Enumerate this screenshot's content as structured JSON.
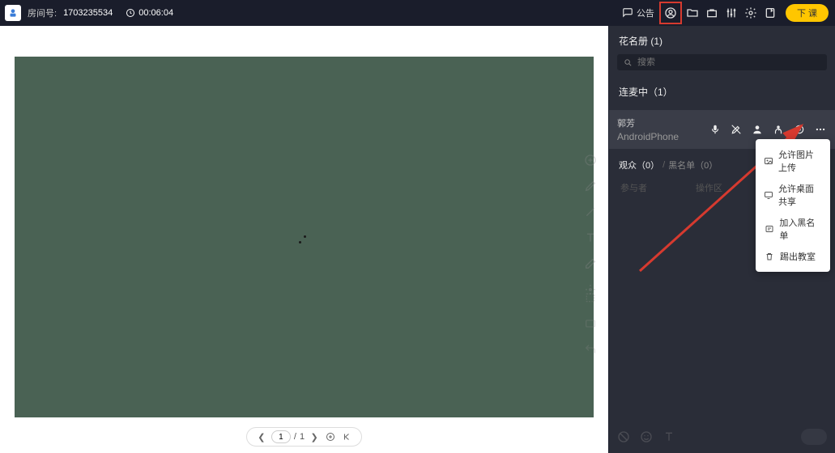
{
  "header": {
    "room_label": "房间号:",
    "room_id": "1703235534",
    "timer": "00:06:04",
    "announce_label": "公告",
    "end_class": "下 课"
  },
  "pager": {
    "current": "1",
    "sep": "/",
    "total": "1"
  },
  "panel": {
    "roster_title": "花名册 (1)",
    "search_placeholder": "搜索",
    "connected_title": "连麦中（1）",
    "audience_tab": "观众（0）",
    "blacklist_tab": "黑名单（0）",
    "separator": "/"
  },
  "user": {
    "name": "郭芳",
    "device": "AndroidPhone"
  },
  "placeholder": {
    "left": "参与者",
    "right": "操作区"
  },
  "dropdown": {
    "item1": "允许图片上传",
    "item2": "允许桌面共享",
    "item3": "加入黑名单",
    "item4": "踢出教室"
  }
}
